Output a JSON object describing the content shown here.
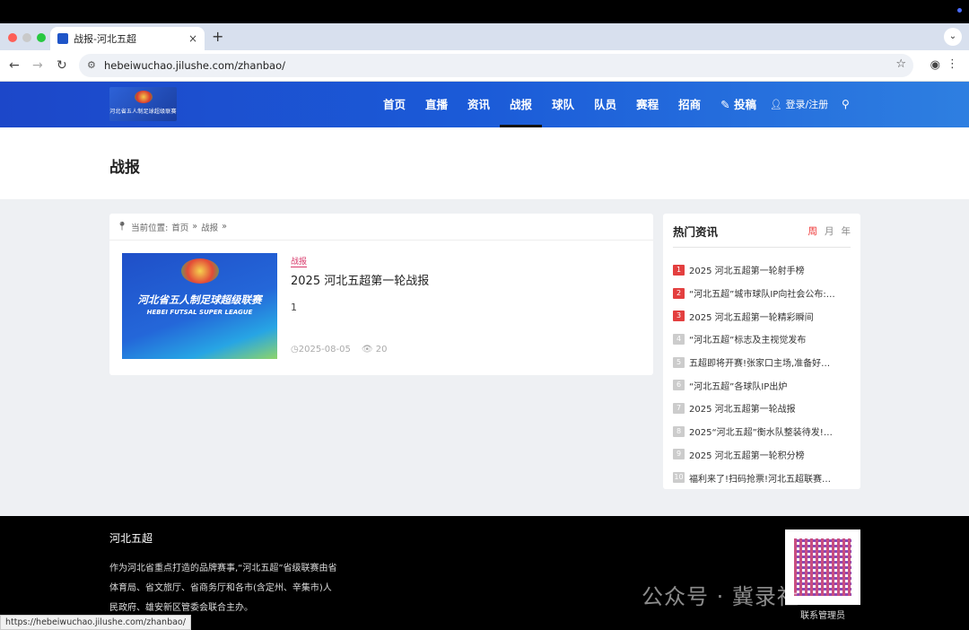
{
  "browser": {
    "tab_title": "战报-河北五超",
    "tab_close": "×",
    "new_tab": "+",
    "url": "hebeiwuchao.jilushe.com/zhanbao/",
    "status_url": "https://hebeiwuchao.jilushe.com/zhanbao/"
  },
  "header": {
    "logo_text": "河北省五人制足球超级联赛",
    "nav": [
      "首页",
      "直播",
      "资讯",
      "战报",
      "球队",
      "队员",
      "赛程",
      "招商",
      "投稿"
    ],
    "active_index": 3,
    "login": "登录/注册"
  },
  "page": {
    "title": "战报"
  },
  "breadcrumb": {
    "label": "当前位置:",
    "home": "首页",
    "sep": "»",
    "current": "战报",
    "tail": "»"
  },
  "post": {
    "tag": "战报",
    "title": "2025 河北五超第一轮战报",
    "excerpt": "1",
    "date": "2025-08-05",
    "views": "20",
    "thumb_line1": "河北省五人制足球超级联赛",
    "thumb_line2": "HEBEI FUTSAL SUPER LEAGUE"
  },
  "sidebar": {
    "title": "热门资讯",
    "periods": [
      "周",
      "月",
      "年"
    ],
    "items": [
      {
        "n": "1",
        "text": "2025 河北五超第一轮射手榜"
      },
      {
        "n": "2",
        "text": "“河北五超”城市球队IP向社会公布:…"
      },
      {
        "n": "3",
        "text": "2025 河北五超第一轮精彩瞬间"
      },
      {
        "n": "4",
        "text": "“河北五超”标志及主视觉发布"
      },
      {
        "n": "5",
        "text": "五超即将开赛!张家口主场,准备好…"
      },
      {
        "n": "6",
        "text": "“河北五超”各球队IP出炉"
      },
      {
        "n": "7",
        "text": "2025 河北五超第一轮战报"
      },
      {
        "n": "8",
        "text": "2025“河北五超”衡水队整装待发!…"
      },
      {
        "n": "9",
        "text": "2025 河北五超第一轮积分榜"
      },
      {
        "n": "10",
        "text": "福利来了!扫码抢票!河北五超联赛…"
      }
    ]
  },
  "footer": {
    "brand": "河北五超",
    "desc": "作为河北省重点打造的品牌赛事,“河北五超”省级联赛由省体育局、省文旅厅、省商务厅和各市(含定州、辛集市)人民政府、雄安新区管委会联合主办。",
    "qr_label": "联系管理员",
    "watermark": "公众号 · 冀录社"
  }
}
